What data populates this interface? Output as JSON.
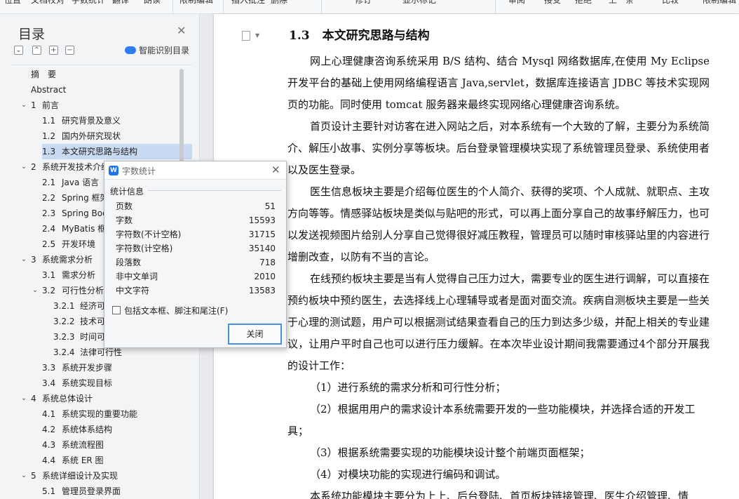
{
  "ribbon": {
    "items": [
      "位置",
      "文档校对",
      "字数统计",
      "翻译",
      "朗读",
      "限制编辑",
      "插入批注",
      "删除",
      "修订",
      "显示标记",
      "审阅",
      "接受",
      "拒绝",
      "上一条",
      "比较",
      "限制编辑"
    ]
  },
  "nav": {
    "title": "目录",
    "smart_label": "智能识别目录",
    "tools": [
      "⌄",
      "⌃",
      "+",
      "−"
    ],
    "toc": [
      {
        "no": "",
        "label": "摘　要",
        "level": 0
      },
      {
        "no": "",
        "label": "Abstract",
        "level": 0
      },
      {
        "no": "1",
        "label": "前言",
        "level": 1,
        "chev": "⌄"
      },
      {
        "no": "1.1",
        "label": "研究背景及意义",
        "level": 2
      },
      {
        "no": "1.2",
        "label": "国内外研究现状",
        "level": 2
      },
      {
        "no": "1.3",
        "label": "本文研究思路与结构",
        "level": 2,
        "selected": true
      },
      {
        "no": "2",
        "label": "系统开发技术介绍",
        "level": 1,
        "chev": "⌄"
      },
      {
        "no": "2.1",
        "label": "Java 语言",
        "level": 2
      },
      {
        "no": "2.2",
        "label": "Spring 框架",
        "level": 2
      },
      {
        "no": "2.3",
        "label": "Spring Boot",
        "level": 2
      },
      {
        "no": "2.4",
        "label": "MyBatis 框架",
        "level": 2
      },
      {
        "no": "2.5",
        "label": "开发环境",
        "level": 2
      },
      {
        "no": "3",
        "label": "系统需求分析",
        "level": 1,
        "chev": "⌄"
      },
      {
        "no": "3.1",
        "label": "需求分析",
        "level": 2
      },
      {
        "no": "3.2",
        "label": "可行性分析",
        "level": 2,
        "chev": "⌄"
      },
      {
        "no": "3.2.1",
        "label": "经济可行性",
        "level": 3
      },
      {
        "no": "3.2.2",
        "label": "技术可行性",
        "level": 3
      },
      {
        "no": "3.2.3",
        "label": "时间可行性",
        "level": 3
      },
      {
        "no": "3.2.4",
        "label": "法律可行性",
        "level": 3
      },
      {
        "no": "3.3",
        "label": "系统开发步骤",
        "level": 2
      },
      {
        "no": "3.4",
        "label": "系统实现目标",
        "level": 2
      },
      {
        "no": "4",
        "label": "系统总体设计",
        "level": 1,
        "chev": "⌄"
      },
      {
        "no": "4.1",
        "label": "系统实现的重要功能",
        "level": 2
      },
      {
        "no": "4.2",
        "label": "系统体系结构",
        "level": 2
      },
      {
        "no": "4.3",
        "label": "系统流程图",
        "level": 2
      },
      {
        "no": "4.4",
        "label": "系统 ER 图",
        "level": 2
      },
      {
        "no": "5",
        "label": "系统详细设计及实现",
        "level": 1,
        "chev": "⌄"
      },
      {
        "no": "5.1",
        "label": "管理员登录界面",
        "level": 2
      }
    ]
  },
  "document": {
    "heading_no": "1.3",
    "heading": "本文研究思路与结构",
    "paragraphs": [
      "网上心理健康咨询系统采用 B/S 结构、结合 Mysql 网络数据库,在使用 My Eclipse 开发平台的基础上使用网络编程语言 Java,servlet，数据库连接语言 JDBC 等技术实现网页的功能。同时使用 tomcat 服务器来最终实现网络心理健康咨询系统。",
      "首页设计主要针对访客在进入网站之后，对本系统有一个大致的了解，主要分为系统简介、解压小故事、实例分享等板块。后台登录管理模块实现了系统管理员登录、系统使用者以及医生登录。",
      "医生信息板块主要是介绍每位医生的个人简介、获得的奖项、个人成就、就职点、主攻方向等等。情感驿站板块是类似与贴吧的形式，可以再上面分享自己的故事纾解压力，也可以发送视频图片给别人分享自己觉得很好减压教程，管理员可以随时审核驿站里的内容进行增删改查，以防有不当的言论。",
      "在线预约板块主要是当有人觉得自己压力过大，需要专业的医生进行调解，可以直接在预约板块中预约医生，去选择线上心理辅导或者是面对面交流。疾病自测板块主要是一些关于心理的测试题，用户可以根据测试结果查看自己的压力到达多少级，并配上相关的专业建议，让用户平时自己也可以进行压力缓解。在本次毕业设计期间我需要通过4个部分开展我的设计工作："
    ],
    "list": [
      "（1）进行系统的需求分析和可行性分析；",
      "（2）根据用用户的需求设计本系统需要开发的一些功能模块，并选择合适的开发工具；",
      "（3）根据系统需要实现的功能模块设计整个前端页面框架；",
      "（4）对模块功能的实现进行编码和调试。"
    ],
    "tail": "本系统功能模块主要分为上上、后台登陆、首页板块链接管理、医生介绍管理、情"
  },
  "dialog": {
    "title": "字数统计",
    "group": "统计信息",
    "stats": [
      {
        "label": "页数",
        "value": "51"
      },
      {
        "label": "字数",
        "value": "15593"
      },
      {
        "label": "字符数(不计空格)",
        "value": "31715"
      },
      {
        "label": "字符数(计空格)",
        "value": "35140"
      },
      {
        "label": "段落数",
        "value": "718"
      },
      {
        "label": "非中文单词",
        "value": "2010"
      },
      {
        "label": "中文字符",
        "value": "13583"
      }
    ],
    "checkbox_label": "包括文本框、脚注和尾注(F)",
    "checkbox_checked": false,
    "close_label": "关闭"
  }
}
